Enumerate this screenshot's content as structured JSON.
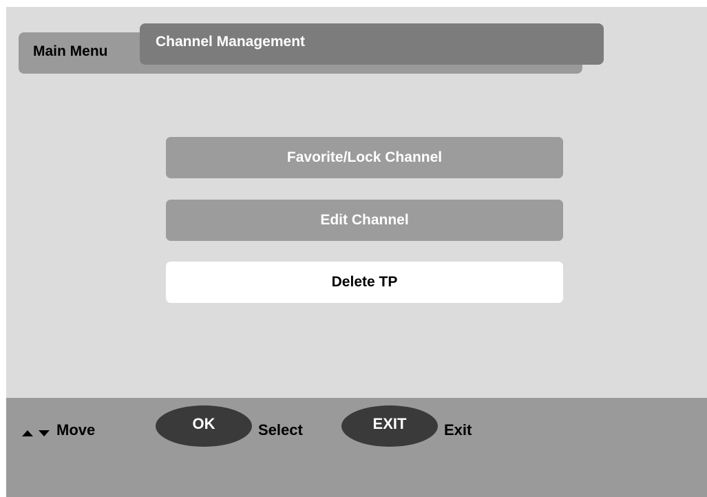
{
  "header": {
    "main_menu_label": "Main Menu",
    "current_menu_label": "Channel Management"
  },
  "menu": {
    "items": [
      {
        "label": "Favorite/Lock Channel",
        "selected": false
      },
      {
        "label": "Edit Channel",
        "selected": false
      },
      {
        "label": "Delete TP",
        "selected": true
      }
    ]
  },
  "footer": {
    "move_label": "Move",
    "ok_key": "OK",
    "select_label": "Select",
    "exit_key": "EXIT",
    "exit_label": "Exit",
    "icons": [
      "up-arrow-icon",
      "down-arrow-icon"
    ]
  },
  "colors": {
    "background": "#dcdcdc",
    "tab_back": "#9a9a9a",
    "tab_front": "#7c7c7c",
    "menu_item": "#9c9c9c",
    "menu_item_selected": "#ffffff",
    "footer": "#9a9a9a",
    "key_pill": "#3a3a3a"
  }
}
